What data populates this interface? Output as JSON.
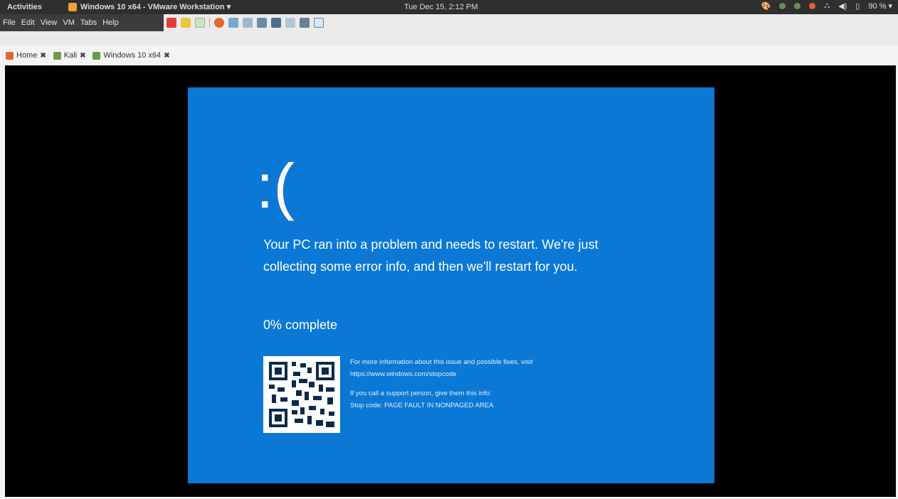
{
  "topbar": {
    "activities": "Activities",
    "app_title": "Windows 10 x64 - VMware Workstation ▾",
    "clock": "Tue Dec 15,  2:12 PM",
    "battery": "90 % ▾",
    "tray_icons": [
      "paint-icon",
      "dot-icon",
      "dot-icon",
      "ubuntu-icon",
      "network-icon",
      "volume-icon",
      "battery-icon"
    ]
  },
  "menu": {
    "items": [
      "File",
      "Edit",
      "View",
      "VM",
      "Tabs",
      "Help"
    ]
  },
  "tabs": [
    {
      "label": "Home",
      "close": "✖"
    },
    {
      "label": "Kali",
      "close": "✖"
    },
    {
      "label": "Windows 10 x64",
      "close": "✖"
    }
  ],
  "bsod": {
    "face": ":(",
    "message": "Your PC ran into a problem and needs to restart. We're just collecting some error info, and then we'll restart for you.",
    "progress": "0% complete",
    "info_line1": "For more information about this issue and possible fixes, visit",
    "info_url": "https://www.windows.com/stopcode",
    "support_line": "If you call a support person, give them this info:",
    "stop_code": "Stop code: PAGE FAULT IN NONPAGED AREA",
    "background_color": "#0b78d6"
  }
}
